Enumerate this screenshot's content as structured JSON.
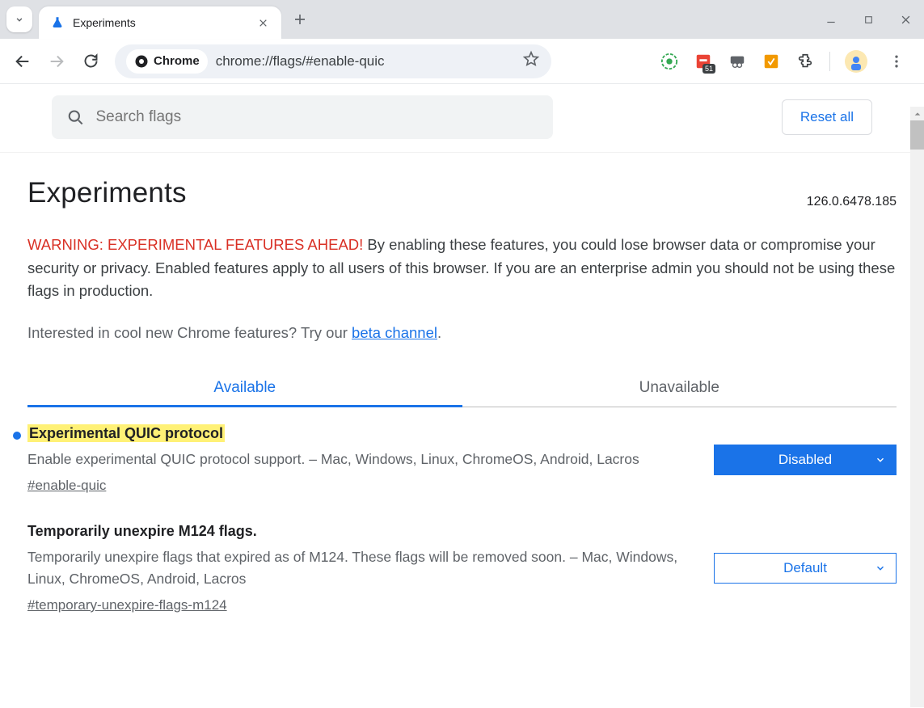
{
  "window": {
    "tab_title": "Experiments",
    "url": "chrome://flags/#enable-quic",
    "chrome_chip": "Chrome",
    "ext_badge_51": "51"
  },
  "searchbar": {
    "placeholder": "Search flags",
    "reset_label": "Reset all"
  },
  "page": {
    "title": "Experiments",
    "version": "126.0.6478.185",
    "warning_label": "WARNING: EXPERIMENTAL FEATURES AHEAD!",
    "warning_body": " By enabling these features, you could lose browser data or compromise your security or privacy. Enabled features apply to all users of this browser. If you are an enterprise admin you should not be using these flags in production.",
    "beta_prefix": "Interested in cool new Chrome features? Try our ",
    "beta_link": "beta channel",
    "beta_suffix": ".",
    "tabs": {
      "available": "Available",
      "unavailable": "Unavailable"
    }
  },
  "flags": [
    {
      "title": "Experimental QUIC protocol",
      "desc": "Enable experimental QUIC protocol support. – Mac, Windows, Linux, ChromeOS, Android, Lacros",
      "hash": "#enable-quic",
      "selected": "Disabled",
      "highlighted": true,
      "modified": true
    },
    {
      "title": "Temporarily unexpire M124 flags.",
      "desc": "Temporarily unexpire flags that expired as of M124. These flags will be removed soon. – Mac, Windows, Linux, ChromeOS, Android, Lacros",
      "hash": "#temporary-unexpire-flags-m124",
      "selected": "Default",
      "highlighted": false,
      "modified": false
    }
  ]
}
